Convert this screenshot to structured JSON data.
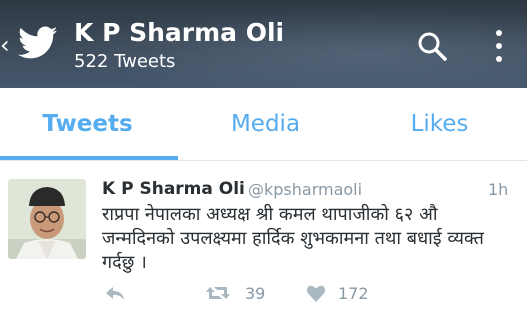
{
  "header": {
    "title": "K P Sharma Oli",
    "subtitle": "522 Tweets",
    "icons": [
      "back-icon",
      "twitter-bird-icon",
      "search-icon",
      "more-vertical-icon"
    ]
  },
  "tabs": [
    {
      "label": "Tweets",
      "active": true
    },
    {
      "label": "Media",
      "active": false
    },
    {
      "label": "Likes",
      "active": false
    }
  ],
  "tweet": {
    "name": "K P Sharma Oli",
    "handle": "@kpsharmaoli",
    "time": "1h",
    "text": "राप्रपा नेपालका अध्यक्ष श्री कमल थापाजीको ६२ औ जन्मदिनको उपलक्ष्यमा हार्दिक शुभकामना तथा बधाई व्यक्त गर्दछु ।",
    "retweets": "39",
    "likes": "172"
  },
  "colors": {
    "accent": "#55acee",
    "header_bg": "#3b4857",
    "text": "#292f33",
    "muted": "#8899a6"
  }
}
